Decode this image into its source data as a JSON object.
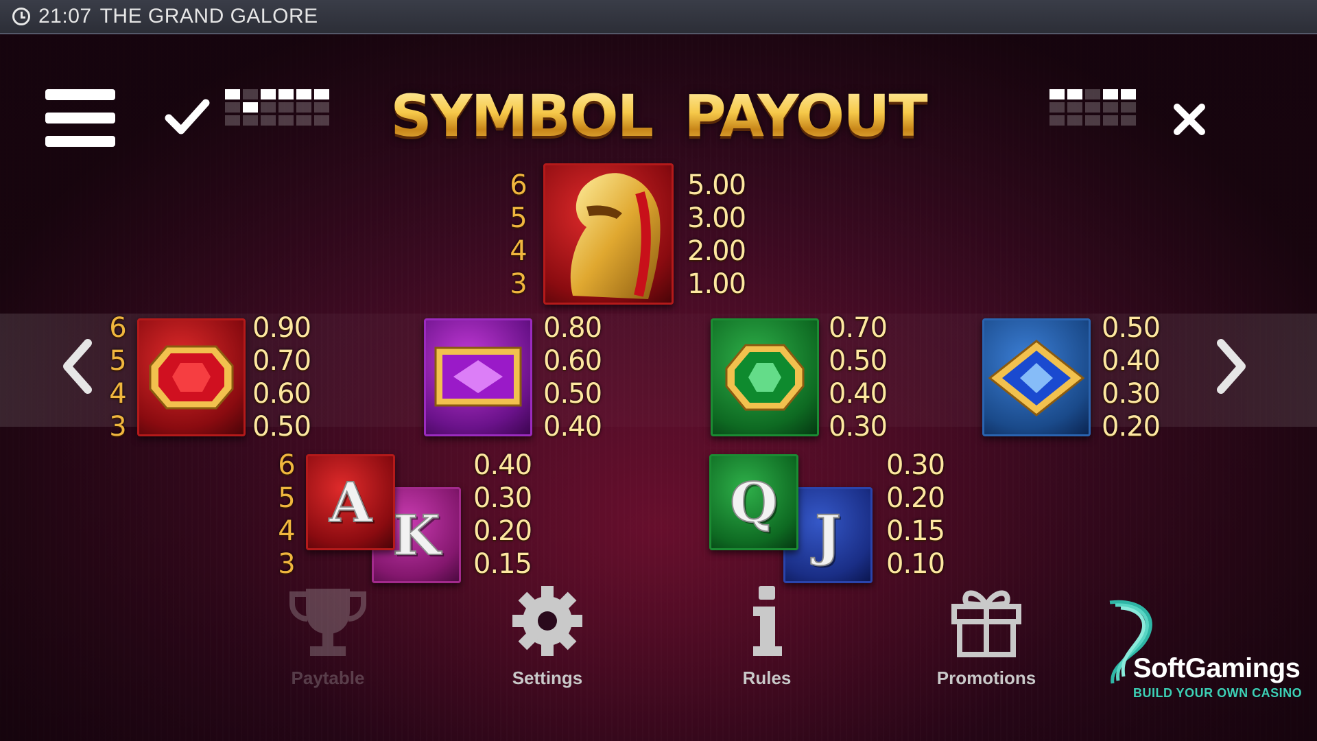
{
  "status_bar": {
    "time": "21:07",
    "game_title": "THE GRAND GALORE"
  },
  "page_title": {
    "word1": "SYMBOL",
    "word2": "PAYOUT"
  },
  "counts": [
    "6",
    "5",
    "4",
    "3"
  ],
  "symbols": {
    "panther": {
      "pays": [
        "5.00",
        "3.00",
        "2.00",
        "1.00"
      ]
    },
    "ruby": {
      "pays": [
        "0.90",
        "0.70",
        "0.60",
        "0.50"
      ]
    },
    "amethyst": {
      "pays": [
        "0.80",
        "0.60",
        "0.50",
        "0.40"
      ]
    },
    "emerald": {
      "pays": [
        "0.70",
        "0.50",
        "0.40",
        "0.30"
      ]
    },
    "sapphire": {
      "pays": [
        "0.50",
        "0.40",
        "0.30",
        "0.20"
      ]
    },
    "ace_king": {
      "letters": [
        "A",
        "K"
      ],
      "pays": [
        "0.40",
        "0.30",
        "0.20",
        "0.15"
      ]
    },
    "queen_jack": {
      "letters": [
        "Q",
        "J"
      ],
      "pays": [
        "0.30",
        "0.20",
        "0.15",
        "0.10"
      ]
    }
  },
  "page_indicator": {
    "total_pages": 6,
    "current_page": 2
  },
  "bottom_menu": [
    {
      "label": "Paytable",
      "icon": "trophy-icon",
      "enabled": false
    },
    {
      "label": "Settings",
      "icon": "gear-icon",
      "enabled": true
    },
    {
      "label": "Rules",
      "icon": "info-icon",
      "enabled": true
    },
    {
      "label": "Promotions",
      "icon": "gift-icon",
      "enabled": true
    }
  ],
  "branding": {
    "name": "SoftGamings",
    "tagline": "BUILD YOUR OWN CASINO"
  },
  "colors": {
    "gold": "#f5c542",
    "status_bar": "#2c2e37",
    "brand_teal": "#3cd1b6"
  }
}
